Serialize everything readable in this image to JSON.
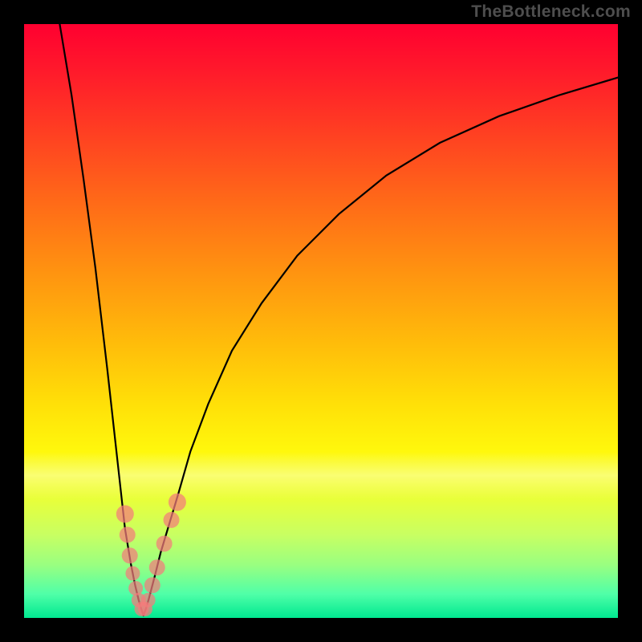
{
  "watermark": "TheBottleneck.com",
  "chart_data": {
    "type": "line",
    "title": "",
    "xlabel": "",
    "ylabel": "",
    "xlim": [
      0,
      100
    ],
    "ylim": [
      0,
      100
    ],
    "grid": false,
    "series": [
      {
        "name": "left-branch",
        "x": [
          6,
          8,
          10,
          12,
          14,
          16,
          17,
          18,
          18.7,
          19.3,
          19.8,
          20.1
        ],
        "y": [
          100,
          88,
          74,
          59,
          42,
          24,
          15,
          9,
          5.5,
          3,
          1.3,
          0.4
        ]
      },
      {
        "name": "right-branch",
        "x": [
          20.1,
          20.5,
          21,
          22,
          23,
          24.5,
          26,
          28,
          31,
          35,
          40,
          46,
          53,
          61,
          70,
          80,
          90,
          100
        ],
        "y": [
          0.4,
          1.5,
          3.2,
          7,
          11,
          16,
          21,
          28,
          36,
          45,
          53,
          61,
          68,
          74.5,
          80,
          84.5,
          88,
          91
        ]
      }
    ],
    "beads": [
      {
        "x": 17.0,
        "y": 17.5,
        "r": 11
      },
      {
        "x": 17.4,
        "y": 14.0,
        "r": 10
      },
      {
        "x": 17.8,
        "y": 10.5,
        "r": 10
      },
      {
        "x": 18.3,
        "y": 7.5,
        "r": 9
      },
      {
        "x": 18.8,
        "y": 5.0,
        "r": 9
      },
      {
        "x": 19.3,
        "y": 3.0,
        "r": 9
      },
      {
        "x": 19.8,
        "y": 1.5,
        "r": 9
      },
      {
        "x": 20.4,
        "y": 1.5,
        "r": 9
      },
      {
        "x": 20.9,
        "y": 3.0,
        "r": 9
      },
      {
        "x": 21.6,
        "y": 5.5,
        "r": 10
      },
      {
        "x": 22.4,
        "y": 8.5,
        "r": 10
      },
      {
        "x": 23.6,
        "y": 12.5,
        "r": 10
      },
      {
        "x": 24.8,
        "y": 16.5,
        "r": 10
      },
      {
        "x": 25.8,
        "y": 19.5,
        "r": 11
      }
    ]
  }
}
